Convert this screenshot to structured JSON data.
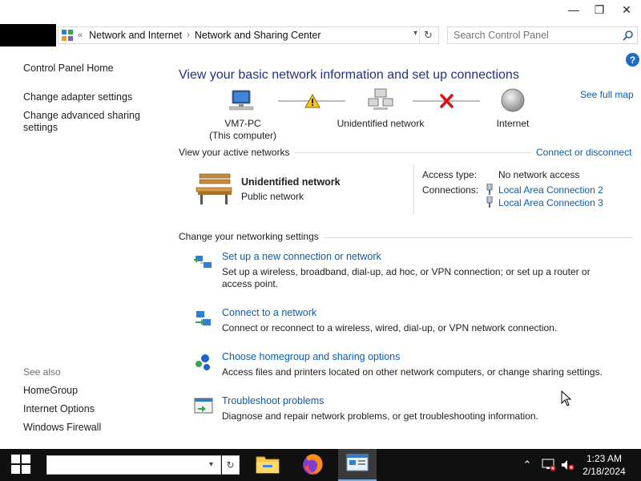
{
  "window": {
    "minimize": "—",
    "maximize": "❐",
    "close": "✕"
  },
  "address": {
    "overflow": "«",
    "crumbs": [
      "Network and Internet",
      "Network and Sharing Center"
    ]
  },
  "search": {
    "placeholder": "Search Control Panel"
  },
  "left_pane": {
    "home": "Control Panel Home",
    "links": [
      "Change adapter settings",
      "Change advanced sharing settings"
    ],
    "see_also_title": "See also",
    "see_also": [
      "HomeGroup",
      "Internet Options",
      "Windows Firewall"
    ]
  },
  "main": {
    "heading": "View your basic network information and set up connections",
    "see_full_map": "See full map",
    "help": "?",
    "map": {
      "computer_name": "VM7-PC",
      "computer_sub": "(This computer)",
      "network": "Unidentified network",
      "internet": "Internet"
    },
    "active_title": "View your active networks",
    "connect_or_disconnect": "Connect or disconnect",
    "active_network": {
      "name": "Unidentified network",
      "type": "Public network",
      "access_label": "Access type:",
      "access_value": "No network access",
      "connections_label": "Connections:",
      "connections": [
        "Local Area Connection 2",
        "Local Area Connection 3"
      ]
    },
    "change_title": "Change your networking settings",
    "tasks": [
      {
        "link": "Set up a new connection or network",
        "desc": "Set up a wireless, broadband, dial-up, ad hoc, or VPN connection; or set up a router or access point."
      },
      {
        "link": "Connect to a network",
        "desc": "Connect or reconnect to a wireless, wired, dial-up, or VPN network connection."
      },
      {
        "link": "Choose homegroup and sharing options",
        "desc": "Access files and printers located on other network computers, or change sharing settings."
      },
      {
        "link": "Troubleshoot problems",
        "desc": "Diagnose and repair network problems, or get troubleshooting information."
      }
    ]
  },
  "taskbar": {
    "tray_chevron": "⌃",
    "time": "1:23 AM",
    "date": "2/18/2024"
  },
  "colors": {
    "link": "#0e5ca8",
    "heading": "#1e3287",
    "taskbar": "#101010"
  }
}
